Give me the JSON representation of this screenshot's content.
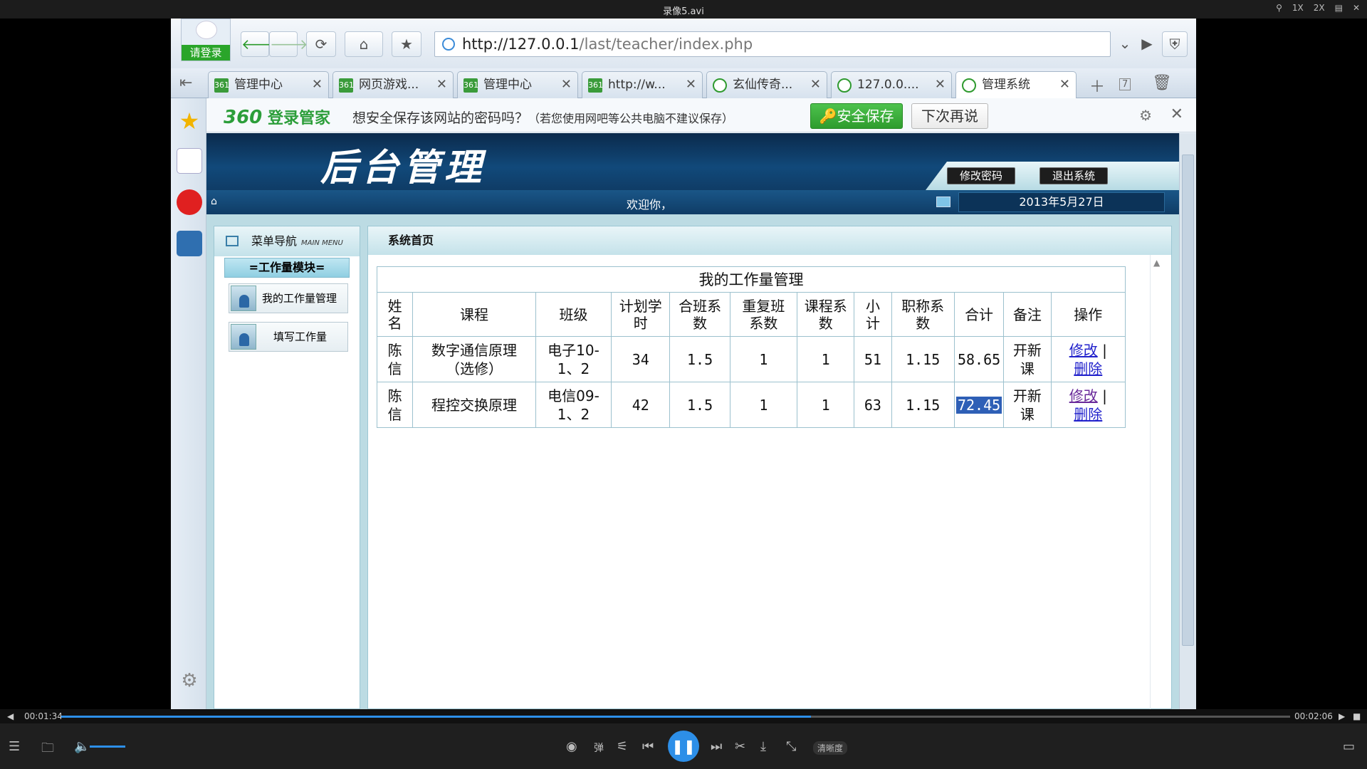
{
  "player": {
    "title": "录像5.avi",
    "controls": [
      "1X",
      "2X"
    ],
    "elapsed": "00:01:34",
    "total": "00:02:06",
    "progress": 0.61,
    "quality": "清晰度",
    "tool_labels": [
      "弹"
    ]
  },
  "browser": {
    "login": "请登录",
    "url_host": "http://127.0.0.1",
    "url_path": "/last/teacher/index.php",
    "tabs": [
      {
        "label": "管理中心",
        "icon": "361"
      },
      {
        "label": "网页游戏...",
        "icon": "361"
      },
      {
        "label": "管理中心",
        "icon": "361"
      },
      {
        "label": "http://w...",
        "icon": "361"
      },
      {
        "label": "玄仙传奇...",
        "icon": "e"
      },
      {
        "label": "127.0.0....",
        "icon": "e"
      },
      {
        "label": "管理系统",
        "icon": "e"
      }
    ],
    "tab_count": "7",
    "infobar": {
      "brand_num": "360",
      "brand_text": "登录管家",
      "message": "想安全保存该网站的密码吗？",
      "note": "（若您使用网吧等公共电脑不建议保存）",
      "save_btn": "安全保存",
      "later_btn": "下次再说"
    }
  },
  "page": {
    "logo": "后台管理",
    "change_pwd": "修改密码",
    "logout": "退出系统",
    "welcome": "欢迎你，",
    "date": "2013年5月27日",
    "menu_title": "菜单导航",
    "menu_sub": "MAIN MENU",
    "module": "=工作量模块=",
    "menu_items": [
      "我的工作量管理",
      "填写工作量"
    ],
    "main_title": "系统首页",
    "table": {
      "caption": "我的工作量管理",
      "headers": [
        "姓名",
        "课程",
        "班级",
        "计划学时",
        "合班系数",
        "重复班系数",
        "课程系数",
        "小计",
        "职称系数",
        "合计",
        "备注",
        "操作"
      ],
      "rows": [
        {
          "name": "陈信",
          "course": "数字通信原理（选修）",
          "class": "电子10-1、2",
          "hours": "34",
          "merge": "1.5",
          "repeat": "1",
          "course_coef": "1",
          "subtotal": "51",
          "title_coef": "1.15",
          "total": "58.65",
          "note": "开新课"
        },
        {
          "name": "陈信",
          "course": "程控交换原理",
          "class": "电信09-1、2",
          "hours": "42",
          "merge": "1.5",
          "repeat": "1",
          "course_coef": "1",
          "subtotal": "63",
          "title_coef": "1.15",
          "total": "72.45",
          "note": "开新课"
        }
      ],
      "edit": "修改",
      "sep": "|",
      "delete": "删除"
    }
  }
}
